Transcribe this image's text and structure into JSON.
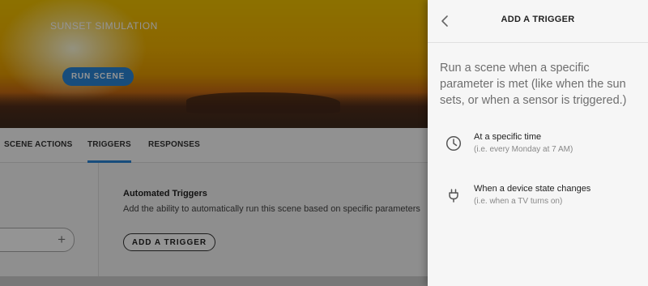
{
  "scene": {
    "title": "SUNSET SIMULATION",
    "run_button": "RUN SCENE"
  },
  "tabs": [
    {
      "label": "SCENE ACTIONS",
      "active": false
    },
    {
      "label": "TRIGGERS",
      "active": true
    },
    {
      "label": "RESPONSES",
      "active": false
    }
  ],
  "triggers_section": {
    "heading": "Automated Triggers",
    "description": "Add the ability to automatically run this scene based on specific parameters",
    "add_button": "ADD A TRIGGER",
    "input_add_icon": "plus-icon"
  },
  "drawer": {
    "back_icon": "chevron-left-icon",
    "title": "ADD A TRIGGER",
    "intro": "Run a scene when a specific parameter is met (like when the sun sets, or when a sensor is triggered.)",
    "options": [
      {
        "icon": "clock-icon",
        "title": "At a specific time",
        "subtitle": "(i.e. every Monday at 7 AM)"
      },
      {
        "icon": "plug-icon",
        "title": "When a device state changes",
        "subtitle": "(i.e. when a TV turns on)"
      }
    ]
  },
  "colors": {
    "accent": "#2a86d6",
    "overlay": "rgba(0,0,0,0.42)",
    "drawer_bg": "#f6f6f6"
  }
}
